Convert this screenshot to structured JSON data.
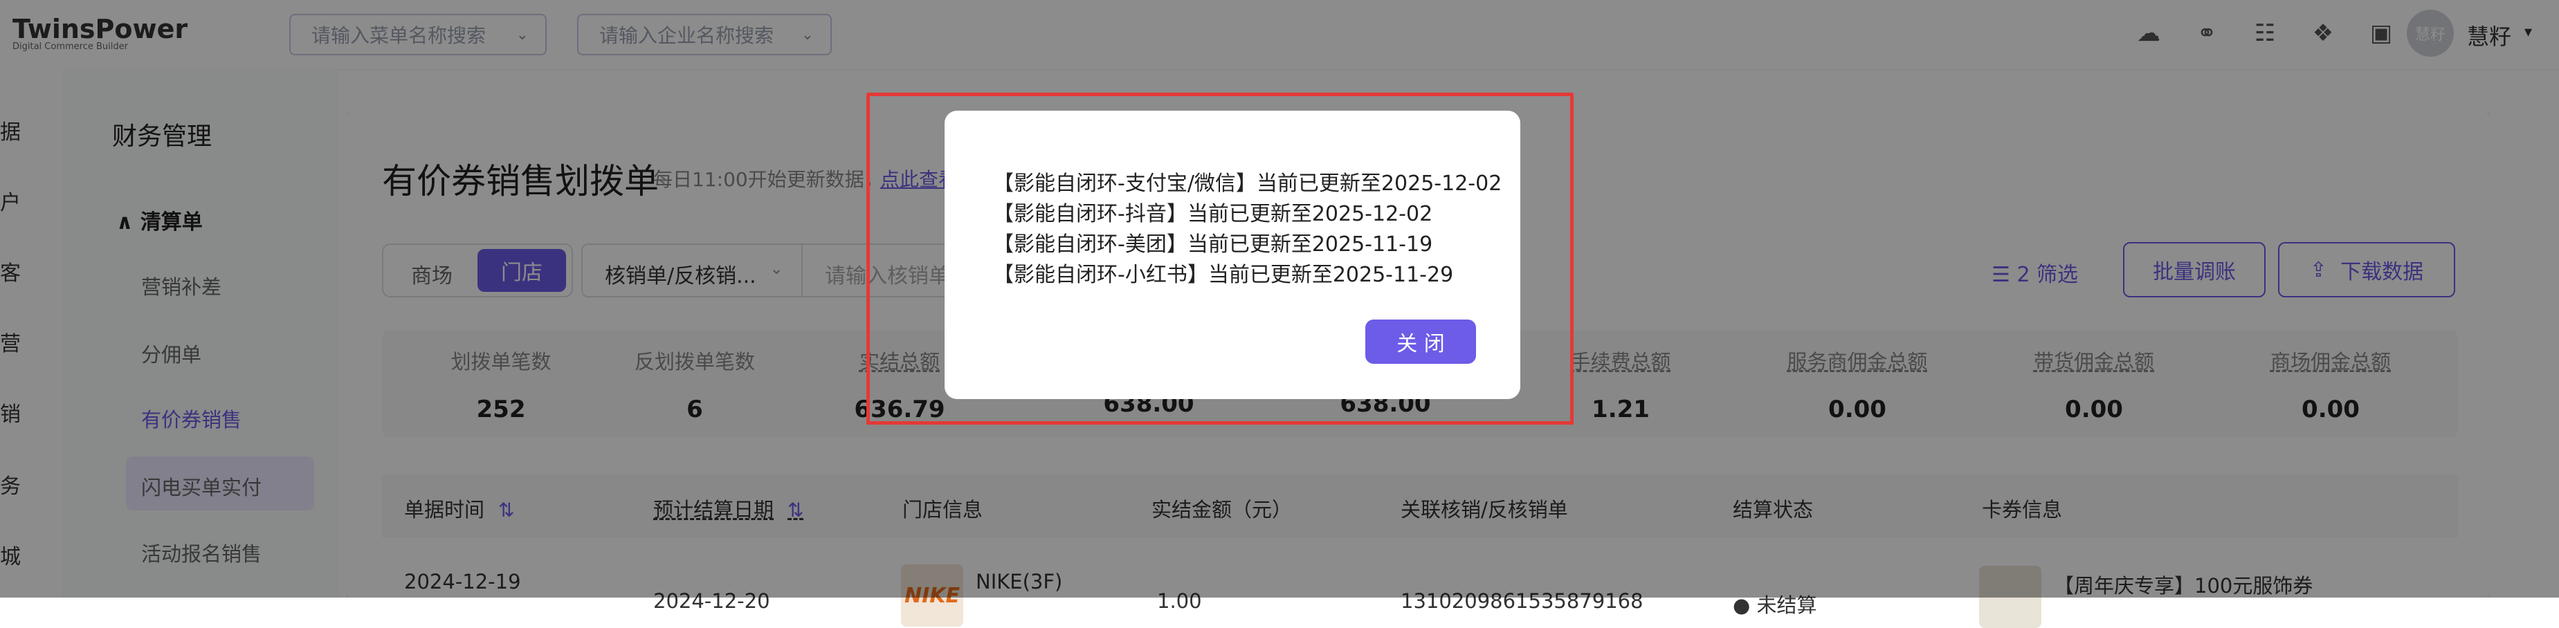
{
  "app": {
    "logo_name": "TwinsPower",
    "logo_sub": "Digital Commerce Builder"
  },
  "search": {
    "menu_placeholder": "请输入菜单名称搜索",
    "company_placeholder": "请输入企业名称搜索"
  },
  "top_icons": [
    "cloud-download-icon",
    "link-icon",
    "database-icon",
    "gift-icon",
    "ticket-icon"
  ],
  "user": {
    "avatar_text": "慧籽",
    "name": "慧籽"
  },
  "nav1": {
    "items": [
      "据",
      "户",
      "客",
      "营",
      "销",
      "务",
      "城"
    ]
  },
  "nav2": {
    "title": "财务管理",
    "group": "清算单",
    "items": [
      "营销补差",
      "分佣单",
      "有价券销售",
      "闪电买单实付",
      "活动报名销售"
    ],
    "active_index": 2
  },
  "main": {
    "title": "有价券销售划拨单",
    "hint": "每日11:00开始更新数据，",
    "hint_link": "点此查看",
    "segment": [
      "商场",
      "门店"
    ],
    "segment_active": "门店",
    "filter_select": "核销单/反核销...",
    "filter_placeholder": "请输入核销单单",
    "filter_count": "2 筛选",
    "adjust_button": "批量调账",
    "download_button": "下载数据"
  },
  "stats": [
    {
      "label": "划拨单笔数",
      "value": "252"
    },
    {
      "label": "反划拨单笔数",
      "value": "6"
    },
    {
      "label": "实结总额",
      "value": "636.79"
    },
    {
      "label": "",
      "value": "638.00"
    },
    {
      "label": "",
      "value": "638.00"
    },
    {
      "label": "手续费总额",
      "value": "1.21"
    },
    {
      "label": "服务商佣金总额",
      "value": "0.00"
    },
    {
      "label": "带货佣金总额",
      "value": "0.00"
    },
    {
      "label": "商场佣金总额",
      "value": "0.00"
    }
  ],
  "table": {
    "headers": [
      "单据时间",
      "预计结算日期",
      "门店信息",
      "实结金额（元）",
      "关联核销/反核销单",
      "结算状态",
      "卡券信息"
    ],
    "rows": [
      {
        "time": "2024-12-19",
        "settle_date": "2024-12-20",
        "store": "NIKE(3F)",
        "store_logo": "NIKE",
        "amount": "1.00",
        "order_no": "1310209861535879168",
        "status": "未结算",
        "coupon": "【周年庆专享】100元服饰券"
      }
    ]
  },
  "modal": {
    "lines": [
      "【影能自闭环-支付宝/微信】当前已更新至2025-12-02",
      "【影能自闭环-抖音】当前已更新至2025-12-02",
      "【影能自闭环-美团】当前已更新至2025-11-19",
      "【影能自闭环-小红书】当前已更新至2025-11-29"
    ],
    "close_label": "关 闭"
  },
  "colors": {
    "accent": "#6c5ce7",
    "highlight": "#e53935",
    "overlay": "rgba(0,0,0,0.45)"
  }
}
